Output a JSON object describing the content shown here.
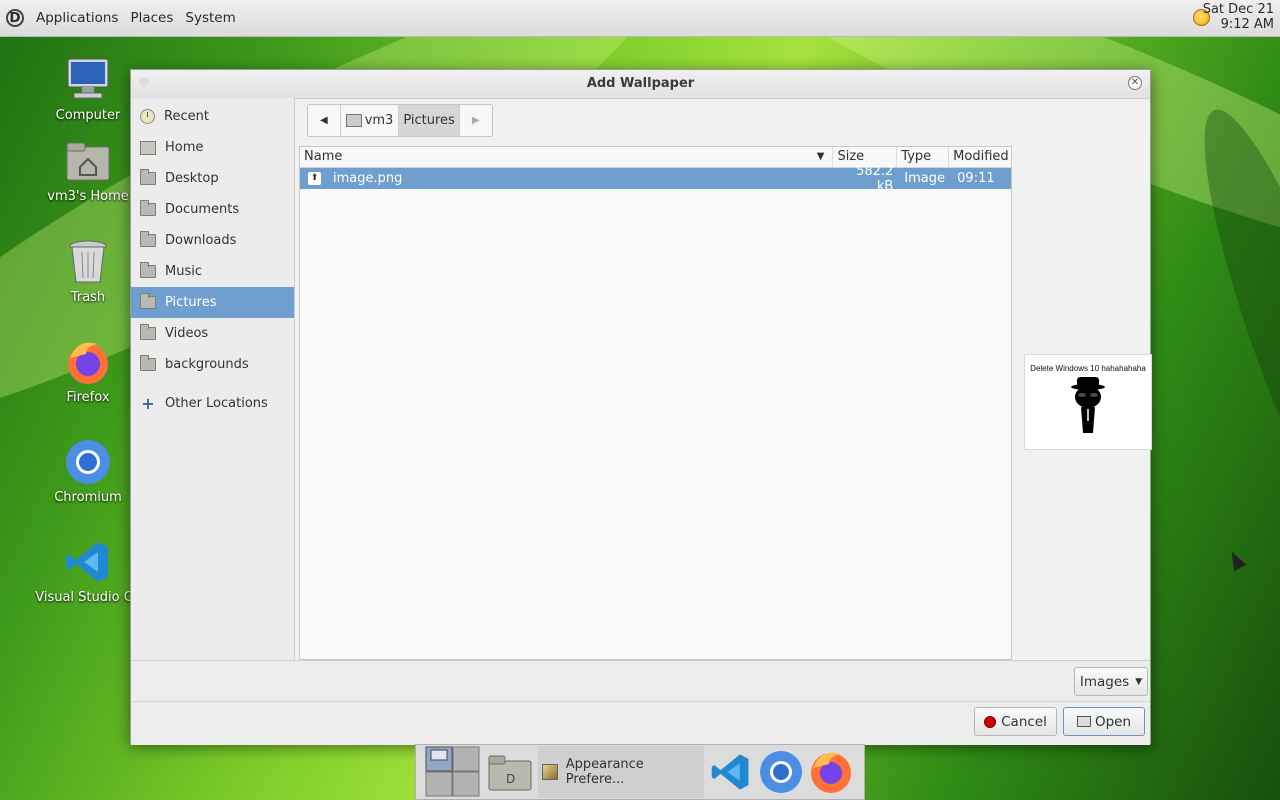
{
  "top_panel": {
    "menus": [
      "Applications",
      "Places",
      "System"
    ],
    "clock_date": "Sat Dec 21",
    "clock_time": "9:12 AM"
  },
  "desktop_icons": [
    {
      "label": "Computer",
      "icon": "computer-icon"
    },
    {
      "label": "vm3's Home",
      "icon": "home-folder-icon"
    },
    {
      "label": "Trash",
      "icon": "trash-icon"
    },
    {
      "label": "Firefox",
      "icon": "firefox-icon"
    },
    {
      "label": "Chromium",
      "icon": "chromium-icon"
    },
    {
      "label": "Visual Studio Co",
      "icon": "vscode-icon"
    }
  ],
  "dialog": {
    "title": "Add Wallpaper",
    "sidebar": [
      {
        "label": "Recent",
        "icon": "recent-icon"
      },
      {
        "label": "Home",
        "icon": "home-icon"
      },
      {
        "label": "Desktop",
        "icon": "folder-icon"
      },
      {
        "label": "Documents",
        "icon": "folder-icon"
      },
      {
        "label": "Downloads",
        "icon": "folder-icon"
      },
      {
        "label": "Music",
        "icon": "folder-icon"
      },
      {
        "label": "Pictures",
        "icon": "folder-icon",
        "selected": true
      },
      {
        "label": "Videos",
        "icon": "folder-icon"
      },
      {
        "label": "backgrounds",
        "icon": "folder-icon"
      },
      {
        "label": "Other Locations",
        "icon": "plus-icon"
      }
    ],
    "path": {
      "parent": "vm3",
      "current": "Pictures"
    },
    "columns": {
      "name": "Name",
      "size": "Size",
      "type": "Type",
      "modified": "Modified"
    },
    "files": [
      {
        "name": "image.png",
        "size": "582.2 kB",
        "type": "Image",
        "modified": "09:11"
      }
    ],
    "preview_caption": "Delete Windows 10 hahahahaha",
    "filter": "Images",
    "cancel": "Cancel",
    "open": "Open"
  },
  "taskbar": {
    "active_window": "Appearance Prefere..."
  },
  "colors": {
    "selection": "#6f9fcf",
    "panel": "#e6e6e6",
    "dialog_bg": "#f1f1f1"
  }
}
